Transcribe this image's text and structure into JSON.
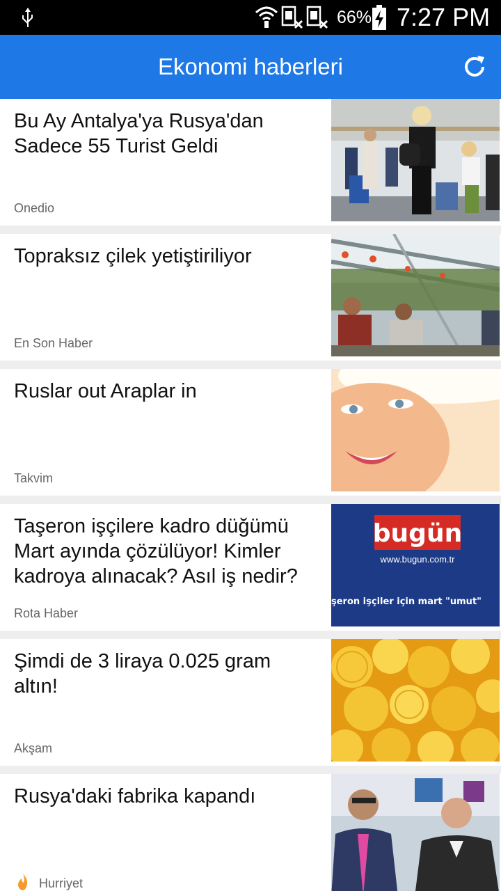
{
  "status_bar": {
    "battery_percent": "66%",
    "time": "7:27 PM"
  },
  "app_bar": {
    "title": "Ekonomi haberleri",
    "refresh_icon": "refresh-icon"
  },
  "articles": [
    {
      "headline": "Bu Ay Antalya'ya Rusya'dan Sadece 55 Turist Geldi",
      "source": "Onedio",
      "image": "airport-tourists-photo"
    },
    {
      "headline": "Topraksız çilek yetiştiriliyor",
      "source": "En Son Haber",
      "image": "greenhouse-strawberry-photo"
    },
    {
      "headline": "Ruslar out Araplar in",
      "source": "Takvim",
      "image": "woman-sun-hat-photo"
    },
    {
      "headline": "Taşeron işçilere kadro düğümü Mart ayında çözülüyor! Kimler kadroya alınacak? Asıl iş nedir?",
      "source": "Rota Haber",
      "image": "bugun-newspaper-banner",
      "image_text": {
        "brand": "bugün",
        "url": "www.bugun.com.tr",
        "caption": "şeron işçiler için mart \"umut\""
      }
    },
    {
      "headline": "Şimdi de 3 liraya 0.025 gram altın!",
      "source": "Akşam",
      "image": "gold-coins-photo"
    },
    {
      "headline": "Rusya'daki fabrika kapandı",
      "source": "Hurriyet",
      "image": "two-men-photo",
      "source_icon": "flame-icon"
    }
  ]
}
